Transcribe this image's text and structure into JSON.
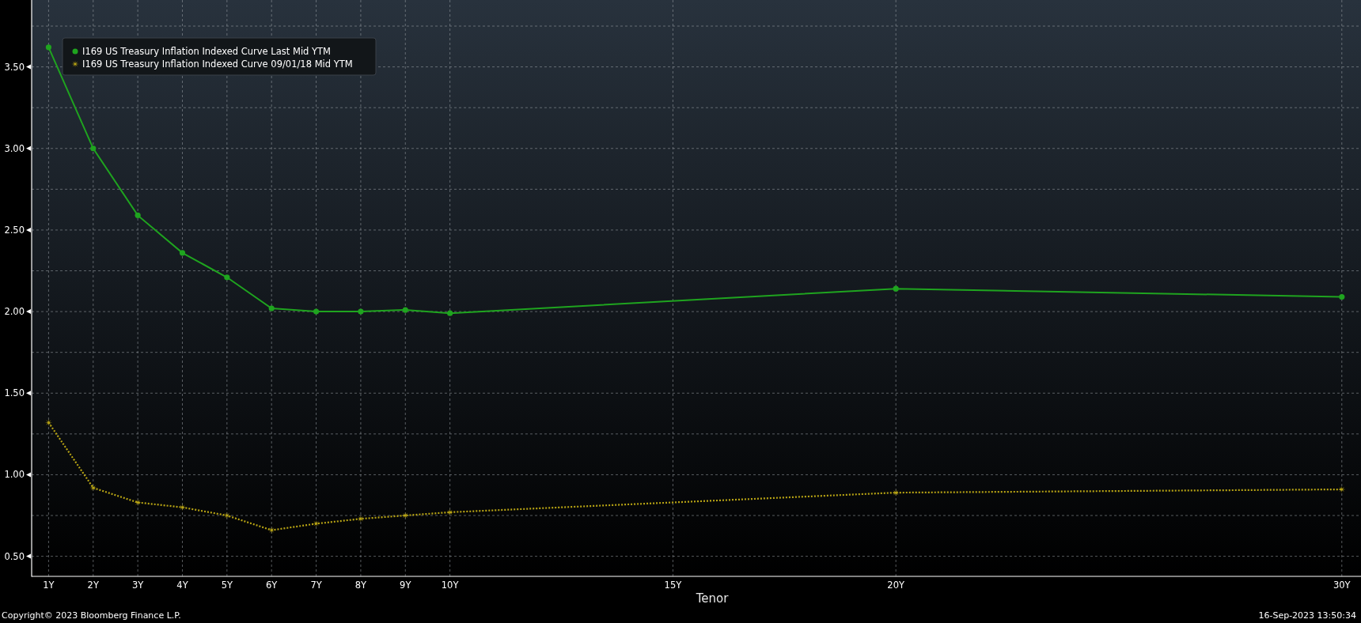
{
  "chart": {
    "chart_data": {
      "type": "line",
      "xlabel": "Tenor",
      "x": [
        1,
        2,
        3,
        4,
        5,
        6,
        7,
        8,
        9,
        10,
        20,
        30
      ],
      "grid": true,
      "legend": true,
      "xlim": [
        0.62,
        30.43
      ],
      "ylim": [
        0.377,
        3.91
      ],
      "xticks": [
        {
          "value": 1,
          "label": "1Y"
        },
        {
          "value": 2,
          "label": "2Y"
        },
        {
          "value": 3,
          "label": "3Y"
        },
        {
          "value": 4,
          "label": "4Y"
        },
        {
          "value": 5,
          "label": "5Y"
        },
        {
          "value": 6,
          "label": "6Y"
        },
        {
          "value": 7,
          "label": "7Y"
        },
        {
          "value": 8,
          "label": "8Y"
        },
        {
          "value": 9,
          "label": "9Y"
        },
        {
          "value": 10,
          "label": "10Y"
        },
        {
          "value": 15,
          "label": "15Y"
        },
        {
          "value": 20,
          "label": "20Y"
        },
        {
          "value": 30,
          "label": "30Y"
        }
      ],
      "yticks": [
        {
          "value": 0.5,
          "label": "0.50"
        },
        {
          "value": 1,
          "label": "1.00"
        },
        {
          "value": 1.5,
          "label": "1.50"
        },
        {
          "value": 2,
          "label": "2.00"
        },
        {
          "value": 2.5,
          "label": "2.50"
        },
        {
          "value": 3,
          "label": "3.00"
        },
        {
          "value": 3.5,
          "label": "3.50"
        }
      ],
      "series": [
        {
          "name": "I169 US Treasury Inflation Indexed Curve Last Mid YTM",
          "color": "#1fa41f",
          "marker": "circle",
          "line_style": "solid",
          "values": [
            3.62,
            3.0,
            2.59,
            2.36,
            2.21,
            2.02,
            2.0,
            2.0,
            2.01,
            1.99,
            2.14,
            2.09
          ]
        },
        {
          "name": "I169 US Treasury Inflation Indexed Curve 09/01/18 Mid YTM",
          "color": "#b8a414",
          "marker": "star",
          "line_style": "dotted",
          "values": [
            1.32,
            0.92,
            0.83,
            0.8,
            0.75,
            0.66,
            0.7,
            0.73,
            0.75,
            0.77,
            0.89,
            0.91
          ]
        }
      ]
    }
  },
  "footer": {
    "copyright": "Copyright© 2023 Bloomberg Finance L.P.",
    "timestamp": "16-Sep-2023 13:50:34"
  }
}
